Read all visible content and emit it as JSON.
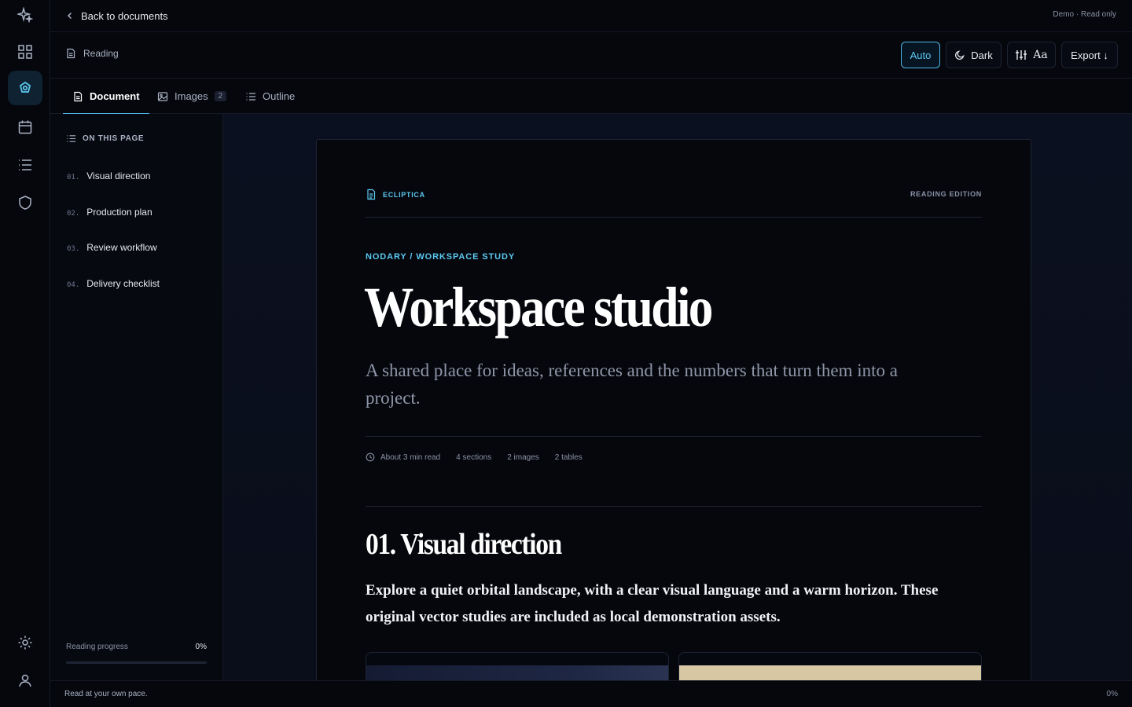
{
  "nav": {
    "back_label": "Back to documents",
    "status": "Demo · Read only",
    "rail_icons": [
      "sparkle-icon",
      "grid-icon",
      "workspace-icon",
      "calendar-icon",
      "list-icon",
      "shield-icon",
      "gear-icon",
      "user-icon"
    ],
    "active_rail_icon": "workspace-icon"
  },
  "toolbar": {
    "mode_label": "Reading",
    "auto_label": "Auto",
    "dark_label": "Dark",
    "typography_label": "Aa",
    "export_label": "Export ↓"
  },
  "tabs": [
    {
      "label": "Document",
      "active": true
    },
    {
      "label": "Images",
      "count": "2",
      "active": false
    },
    {
      "label": "Outline",
      "active": false
    }
  ],
  "sidebar": {
    "title": "ON THIS PAGE",
    "items": [
      {
        "num": "01.",
        "label": "Visual direction"
      },
      {
        "num": "02.",
        "label": "Production plan"
      },
      {
        "num": "03.",
        "label": "Review workflow"
      },
      {
        "num": "04.",
        "label": "Delivery checklist"
      }
    ],
    "progress_label": "Reading progress",
    "progress_value": "0%",
    "progress_fraction": 0
  },
  "document": {
    "brand": "ECLIPTICA",
    "edition": "READING EDITION",
    "kicker": "NODARY / WORKSPACE STUDY",
    "title": "Workspace studio",
    "subtitle": "A shared place for ideas, references and the numbers that turn them into a project.",
    "meta": {
      "read_time": "About 3 min read",
      "sections": "4 sections",
      "images": "2 images",
      "tables": "2 tables"
    },
    "section_title": "01. Visual direction",
    "section_body": "Explore a quiet orbital landscape, with a clear visual language and a warm horizon. These original vector studies are included as local demonstration assets."
  },
  "footer": {
    "left": "Read at your own pace.",
    "right": "0%"
  },
  "colors": {
    "accent": "#5cc8f0",
    "background": "#05070d",
    "panel": "#070910"
  }
}
